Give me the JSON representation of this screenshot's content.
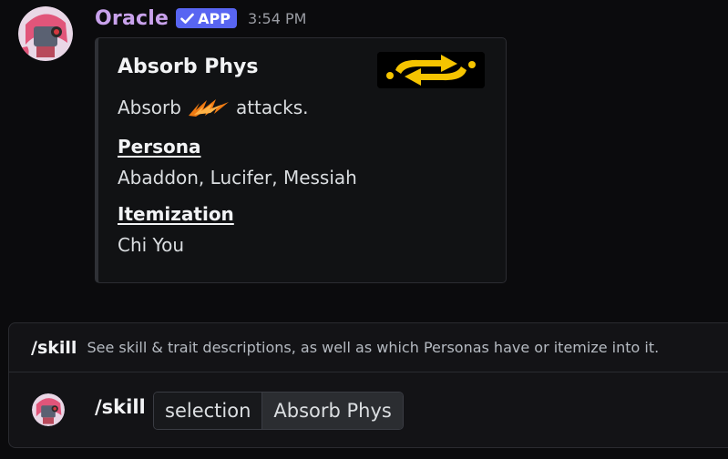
{
  "message": {
    "author": "Oracle",
    "badge": "APP",
    "timestamp": "3:54 PM",
    "colors": {
      "username": "#c9a2ec",
      "badge": "#5865f2"
    }
  },
  "embed": {
    "title": "Absorb Phys",
    "thumbnail_icon": "absorb-arrows-icon",
    "description_before": "Absorb",
    "description_emoji": "phys-slash-icon",
    "description_after": "attacks.",
    "fields": [
      {
        "name": "Persona",
        "value": "Abaddon, Lucifer, Messiah"
      },
      {
        "name": "Itemization",
        "value": "Chi You"
      }
    ]
  },
  "command_suggestion": {
    "command": "/skill",
    "description": "See skill & trait descriptions, as well as which Personas have or itemize into it."
  },
  "input": {
    "command": "/skill",
    "option_name": "selection",
    "option_value": "Absorb Phys"
  }
}
